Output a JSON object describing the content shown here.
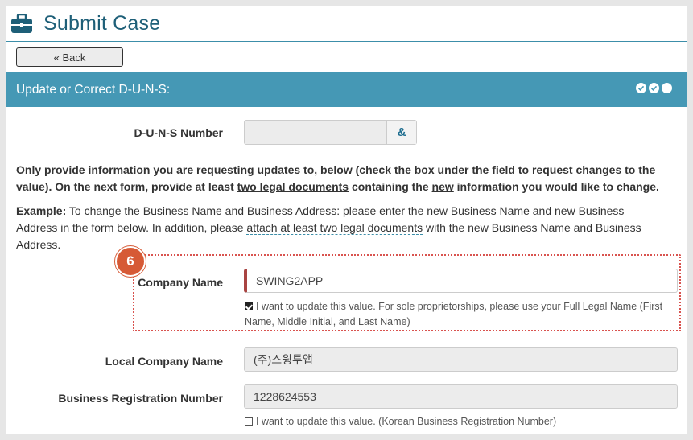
{
  "header": {
    "title": "Submit Case",
    "icon": "briefcase-icon",
    "accent": "#1e5f78"
  },
  "nav": {
    "back_label": "« Back"
  },
  "section": {
    "title": "Update or Correct D-U-N-S:",
    "bar_color": "#4598b5",
    "progress_dots": 3
  },
  "duns": {
    "label": "D-U-N-S Number",
    "value": "",
    "search_button": "&"
  },
  "instructions": {
    "line1_u1": "Only provide information you are requesting updates to",
    "line1_rest": ", below (check the box under the field to request changes to the value). On the next form, provide at least ",
    "u2": "two legal documents",
    "mid": " containing the ",
    "u3": "new",
    "tail": " information you would like to change."
  },
  "example": {
    "lead": "Example:",
    "text1": " To change the Business Name and Business Address: please enter the new Business Name and new Business Address in the form below.  In addition, please ",
    "link": "attach at least two legal documents",
    "text2": "  with the new Business Name and Business Address."
  },
  "step_badge": "6",
  "company": {
    "label": "Company Name",
    "value": "SWING2APP",
    "checkbox_checked": true,
    "checkbox_text": "I want to update this value. For sole proprietorships, please use your Full Legal Name (First Name, Middle Initial, and Last Name)"
  },
  "local_company": {
    "label": "Local Company Name",
    "value": "(주)스윙투앱"
  },
  "business_reg": {
    "label": "Business Registration Number",
    "value": "1228624553",
    "checkbox_checked": false,
    "checkbox_text": "I want to update this value. (Korean Business Registration Number)"
  }
}
